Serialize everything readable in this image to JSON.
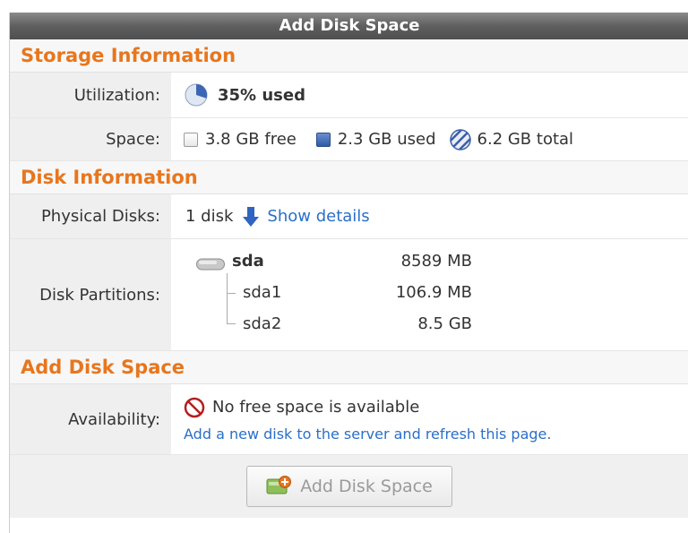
{
  "window": {
    "title": "Add Disk Space"
  },
  "storage": {
    "heading": "Storage Information",
    "utilization_label": "Utilization:",
    "utilization_value": "35% used",
    "utilization_fraction": 0.35,
    "space_label": "Space:",
    "free": "3.8 GB free",
    "used": "2.3 GB used",
    "total": "6.2 GB total"
  },
  "disk": {
    "heading": "Disk Information",
    "physical_label": "Physical Disks:",
    "physical_value": "1 disk",
    "show_details": "Show details",
    "partitions_label": "Disk Partitions:",
    "partitions": [
      {
        "name": "sda",
        "size": "8589 MB"
      },
      {
        "name": "sda1",
        "size": "106.9 MB"
      },
      {
        "name": "sda2",
        "size": "8.5 GB"
      }
    ]
  },
  "add": {
    "heading": "Add Disk Space",
    "availability_label": "Availability:",
    "status": "No free space is available",
    "hint_link": "Add a new disk to the server and refresh this page.",
    "button_label": "Add Disk Space"
  },
  "colors": {
    "accent": "#e8761d",
    "link": "#2a6fc9",
    "titlebar": "#5f5f5f"
  }
}
